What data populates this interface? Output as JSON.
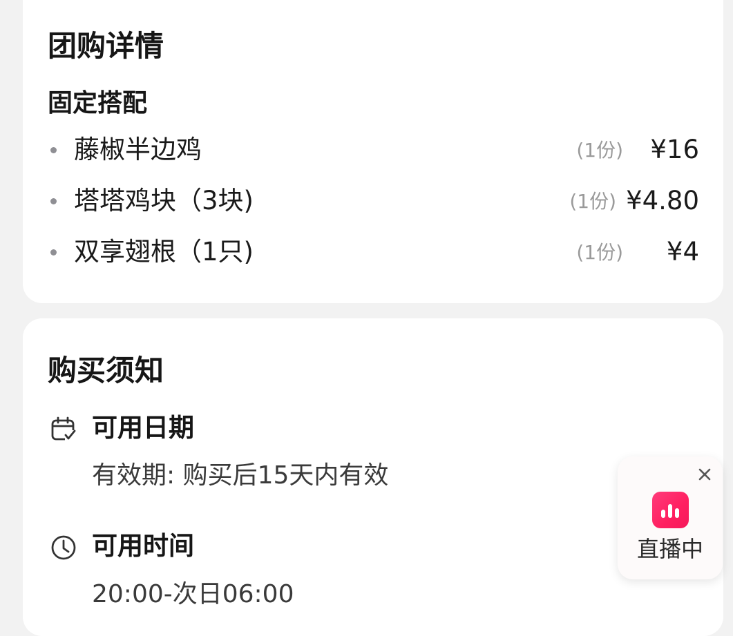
{
  "detail": {
    "title": "团购详情",
    "subtitle": "固定搭配",
    "items": [
      {
        "name": "藤椒半边鸡",
        "qty": "(1份)",
        "price": "¥16"
      },
      {
        "name": "塔塔鸡块（3块)",
        "qty": "(1份)",
        "price": "¥4.80"
      },
      {
        "name": "双享翅根（1只)",
        "qty": "(1份)",
        "price": "¥4"
      }
    ]
  },
  "notice": {
    "title": "购买须知",
    "sections": [
      {
        "icon": "calendar-check-icon",
        "label": "可用日期",
        "text": "有效期: 购买后15天内有效"
      },
      {
        "icon": "clock-icon",
        "label": "可用时间",
        "text": "20:00-次日06:00"
      }
    ]
  },
  "live_widget": {
    "label": "直播中",
    "close_icon": "close-icon",
    "badge_icon": "live-bars-icon",
    "accent_color": "#ff2d6f"
  }
}
